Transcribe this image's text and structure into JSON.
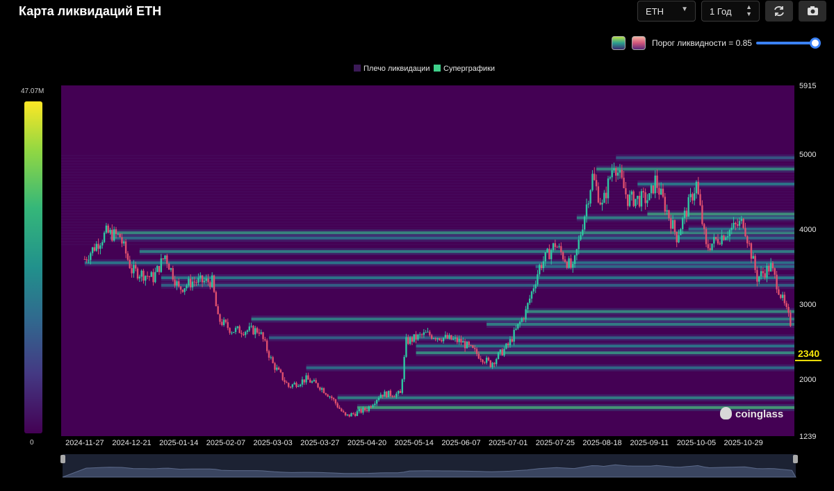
{
  "header": {
    "title": "Карта ликвидаций ETH",
    "symbol_select": "ETH",
    "period_select": "1 Год",
    "threshold_label": "Порог ликвидности = 0.85",
    "threshold_value": 0.85
  },
  "icons": [
    "refresh-icon",
    "camera-icon",
    "chevron-down-icon",
    "stepper-icon"
  ],
  "colors": {
    "background": "#000000",
    "heatmap_base": "#440154",
    "heatmap_high": "#fde725",
    "candle_up": "#2ec7a2",
    "candle_down": "#e0506e",
    "current_price": "#f5e50a",
    "slider": "#3b82f6"
  },
  "colorbar": {
    "max_label": "47.07M",
    "min_label": "0"
  },
  "logo": {
    "text": "coinglass"
  },
  "chart_data": {
    "type": "heatmap",
    "title": "",
    "legend": [
      "Плечо ликвидации",
      "Суперграфики"
    ],
    "legend_colors": [
      "#3b1a57",
      "#3fd08a"
    ],
    "legend_placement": "top-center",
    "ylim": [
      1239,
      5915
    ],
    "y_ticks": [
      5915,
      5000,
      4000,
      3000,
      2000,
      1239
    ],
    "current_price": 2340,
    "x_ticks": [
      "2024-11-27",
      "2024-12-21",
      "2025-01-14",
      "2025-02-07",
      "2025-03-03",
      "2025-03-27",
      "2025-04-20",
      "2025-05-14",
      "2025-06-07",
      "2025-07-01",
      "2025-07-25",
      "2025-08-18",
      "2025-09-11",
      "2025-10-05",
      "2025-10-29"
    ],
    "price_path": [
      {
        "date": "2024-11-27",
        "price": 3600
      },
      {
        "date": "2024-12-08",
        "price": 3950
      },
      {
        "date": "2024-12-15",
        "price": 3900
      },
      {
        "date": "2024-12-21",
        "price": 3450
      },
      {
        "date": "2025-01-01",
        "price": 3350
      },
      {
        "date": "2025-01-07",
        "price": 3650
      },
      {
        "date": "2025-01-14",
        "price": 3200
      },
      {
        "date": "2025-01-21",
        "price": 3300
      },
      {
        "date": "2025-01-31",
        "price": 3300
      },
      {
        "date": "2025-02-03",
        "price": 2800
      },
      {
        "date": "2025-02-10",
        "price": 2650
      },
      {
        "date": "2025-02-24",
        "price": 2650
      },
      {
        "date": "2025-03-03",
        "price": 2200
      },
      {
        "date": "2025-03-11",
        "price": 1900
      },
      {
        "date": "2025-03-20",
        "price": 2000
      },
      {
        "date": "2025-03-27",
        "price": 1900
      },
      {
        "date": "2025-04-02",
        "price": 1750
      },
      {
        "date": "2025-04-09",
        "price": 1500
      },
      {
        "date": "2025-04-20",
        "price": 1600
      },
      {
        "date": "2025-04-27",
        "price": 1800
      },
      {
        "date": "2025-05-07",
        "price": 1800
      },
      {
        "date": "2025-05-10",
        "price": 2500
      },
      {
        "date": "2025-05-20",
        "price": 2600
      },
      {
        "date": "2025-06-07",
        "price": 2500
      },
      {
        "date": "2025-06-22",
        "price": 2200
      },
      {
        "date": "2025-07-01",
        "price": 2450
      },
      {
        "date": "2025-07-10",
        "price": 2900
      },
      {
        "date": "2025-07-17",
        "price": 3500
      },
      {
        "date": "2025-07-25",
        "price": 3800
      },
      {
        "date": "2025-08-03",
        "price": 3450
      },
      {
        "date": "2025-08-09",
        "price": 4200
      },
      {
        "date": "2025-08-13",
        "price": 4700
      },
      {
        "date": "2025-08-18",
        "price": 4300
      },
      {
        "date": "2025-08-24",
        "price": 4900
      },
      {
        "date": "2025-08-31",
        "price": 4400
      },
      {
        "date": "2025-09-11",
        "price": 4400
      },
      {
        "date": "2025-09-14",
        "price": 4650
      },
      {
        "date": "2025-09-25",
        "price": 3900
      },
      {
        "date": "2025-10-05",
        "price": 4600
      },
      {
        "date": "2025-10-10",
        "price": 3750
      },
      {
        "date": "2025-10-20",
        "price": 3950
      },
      {
        "date": "2025-10-29",
        "price": 4100
      },
      {
        "date": "2025-11-05",
        "price": 3350
      },
      {
        "date": "2025-11-12",
        "price": 3500
      },
      {
        "date": "2025-11-22",
        "price": 2750
      }
    ],
    "liquidation_bands": [
      {
        "start": "2024-11-27",
        "price": 3550,
        "intensity": 0.5
      },
      {
        "start": "2024-12-10",
        "price": 3950,
        "intensity": 0.6
      },
      {
        "start": "2024-12-10",
        "price": 3880,
        "intensity": 0.45
      },
      {
        "start": "2024-12-25",
        "price": 3700,
        "intensity": 0.55
      },
      {
        "start": "2025-01-05",
        "price": 3350,
        "intensity": 0.5
      },
      {
        "start": "2025-01-05",
        "price": 3250,
        "intensity": 0.4
      },
      {
        "start": "2025-02-20",
        "price": 2800,
        "intensity": 0.55
      },
      {
        "start": "2025-03-01",
        "price": 2550,
        "intensity": 0.4
      },
      {
        "start": "2025-03-20",
        "price": 2150,
        "intensity": 0.45
      },
      {
        "start": "2025-04-05",
        "price": 1750,
        "intensity": 0.55
      },
      {
        "start": "2025-04-15",
        "price": 1620,
        "intensity": 0.7
      },
      {
        "start": "2025-05-15",
        "price": 2350,
        "intensity": 0.6
      },
      {
        "start": "2025-05-15",
        "price": 2440,
        "intensity": 0.5
      },
      {
        "start": "2025-06-20",
        "price": 2730,
        "intensity": 0.55
      },
      {
        "start": "2025-07-10",
        "price": 2900,
        "intensity": 0.6
      },
      {
        "start": "2025-07-15",
        "price": 3500,
        "intensity": 0.45
      },
      {
        "start": "2025-08-05",
        "price": 4150,
        "intensity": 0.55
      },
      {
        "start": "2025-08-15",
        "price": 4800,
        "intensity": 0.6
      },
      {
        "start": "2025-08-25",
        "price": 4950,
        "intensity": 0.35
      },
      {
        "start": "2025-09-05",
        "price": 4600,
        "intensity": 0.5
      },
      {
        "start": "2025-09-10",
        "price": 4200,
        "intensity": 0.65
      },
      {
        "start": "2025-10-01",
        "price": 4000,
        "intensity": 0.45
      }
    ]
  }
}
